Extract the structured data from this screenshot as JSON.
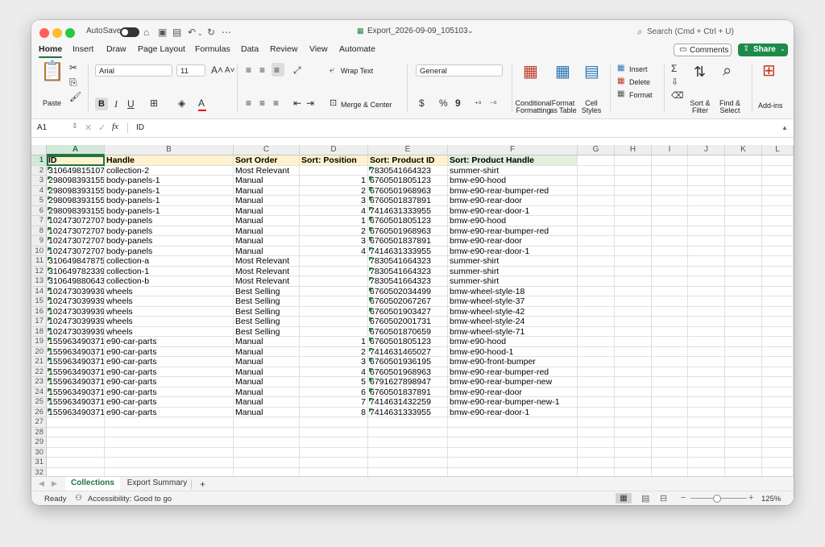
{
  "window": {
    "title": "Export_2026-09-09_105103",
    "autosave_label": "AutoSave",
    "search_placeholder": "Search (Cmd + Ctrl + U)",
    "comments_label": "Comments",
    "share_label": "Share"
  },
  "menu_tabs": [
    "Home",
    "Insert",
    "Draw",
    "Page Layout",
    "Formulas",
    "Data",
    "Review",
    "View",
    "Automate"
  ],
  "active_tab": "Home",
  "ribbon": {
    "paste": "Paste",
    "font_name": "Arial",
    "font_size": "11",
    "bold": "B",
    "italic": "I",
    "underline": "U",
    "wrap_text": "Wrap Text",
    "merge_center": "Merge & Center",
    "number_format": "General",
    "currency": "$",
    "percent": "%",
    "comma": "9",
    "conditional_formatting": "Conditional Formatting",
    "format_as_table": "Format as Table",
    "cell_styles": "Cell Styles",
    "insert": "Insert",
    "delete": "Delete",
    "format": "Format",
    "sort_filter": "Sort & Filter",
    "find_select": "Find & Select",
    "addins": "Add-ins"
  },
  "formula_bar": {
    "cell_ref": "A1",
    "fx_label": "fx",
    "content": "ID"
  },
  "columns": [
    "A",
    "B",
    "C",
    "D",
    "E",
    "F",
    "G",
    "H",
    "I",
    "J",
    "K",
    "L"
  ],
  "headers": [
    "ID",
    "Handle",
    "Sort Order",
    "Sort: Position",
    "Sort: Product ID",
    "Sort: Product Handle"
  ],
  "rows": [
    [
      "310649815107",
      "collection-2",
      "Most Relevant",
      "",
      "7830541664323",
      "summer-shirt"
    ],
    [
      "298098393155",
      "body-panels-1",
      "Manual",
      "1",
      "6760501805123",
      "bmw-e90-hood"
    ],
    [
      "298098393155",
      "body-panels-1",
      "Manual",
      "2",
      "6760501968963",
      "bmw-e90-rear-bumper-red"
    ],
    [
      "298098393155",
      "body-panels-1",
      "Manual",
      "3",
      "6760501837891",
      "bmw-e90-rear-door"
    ],
    [
      "298098393155",
      "body-panels-1",
      "Manual",
      "4",
      "7414631333955",
      "bmw-e90-rear-door-1"
    ],
    [
      "102473072707",
      "body-panels",
      "Manual",
      "1",
      "6760501805123",
      "bmw-e90-hood"
    ],
    [
      "102473072707",
      "body-panels",
      "Manual",
      "2",
      "6760501968963",
      "bmw-e90-rear-bumper-red"
    ],
    [
      "102473072707",
      "body-panels",
      "Manual",
      "3",
      "6760501837891",
      "bmw-e90-rear-door"
    ],
    [
      "102473072707",
      "body-panels",
      "Manual",
      "4",
      "7414631333955",
      "bmw-e90-rear-door-1"
    ],
    [
      "310649847875",
      "collection-a",
      "Most Relevant",
      "",
      "7830541664323",
      "summer-shirt"
    ],
    [
      "310649782339",
      "collection-1",
      "Most Relevant",
      "",
      "7830541664323",
      "summer-shirt"
    ],
    [
      "310649880643",
      "collection-b",
      "Most Relevant",
      "",
      "7830541664323",
      "summer-shirt"
    ],
    [
      "102473039939",
      "wheels",
      "Best Selling",
      "",
      "6760502034499",
      "bmw-wheel-style-18"
    ],
    [
      "102473039939",
      "wheels",
      "Best Selling",
      "",
      "6760502067267",
      "bmw-wheel-style-37"
    ],
    [
      "102473039939",
      "wheels",
      "Best Selling",
      "",
      "6760501903427",
      "bmw-wheel-style-42"
    ],
    [
      "102473039939",
      "wheels",
      "Best Selling",
      "",
      "6760502001731",
      "bmw-wheel-style-24"
    ],
    [
      "102473039939",
      "wheels",
      "Best Selling",
      "",
      "6760501870659",
      "bmw-wheel-style-71"
    ],
    [
      "155963490371",
      "e90-car-parts",
      "Manual",
      "1",
      "6760501805123",
      "bmw-e90-hood"
    ],
    [
      "155963490371",
      "e90-car-parts",
      "Manual",
      "2",
      "7414631465027",
      "bmw-e90-hood-1"
    ],
    [
      "155963490371",
      "e90-car-parts",
      "Manual",
      "3",
      "6760501936195",
      "bmw-e90-front-bumper"
    ],
    [
      "155963490371",
      "e90-car-parts",
      "Manual",
      "4",
      "6760501968963",
      "bmw-e90-rear-bumper-red"
    ],
    [
      "155963490371",
      "e90-car-parts",
      "Manual",
      "5",
      "6791627898947",
      "bmw-e90-rear-bumper-new"
    ],
    [
      "155963490371",
      "e90-car-parts",
      "Manual",
      "6",
      "6760501837891",
      "bmw-e90-rear-door"
    ],
    [
      "155963490371",
      "e90-car-parts",
      "Manual",
      "7",
      "7414631432259",
      "bmw-e90-rear-bumper-new-1"
    ],
    [
      "155963490371",
      "e90-car-parts",
      "Manual",
      "8",
      "7414631333955",
      "bmw-e90-rear-door-1"
    ]
  ],
  "row_count": 33,
  "sheets": [
    "Collections",
    "Export Summary"
  ],
  "active_sheet": "Collections",
  "add_sheet": "+",
  "status": {
    "ready": "Ready",
    "accessibility": "Accessibility: Good to go",
    "zoom": "125%",
    "zoom_minus": "−",
    "zoom_plus": "+"
  },
  "colors": {
    "accent": "#217346",
    "header_yellow": "#fff2cc",
    "header_green": "#e2efda",
    "share": "#1e8a4a"
  }
}
